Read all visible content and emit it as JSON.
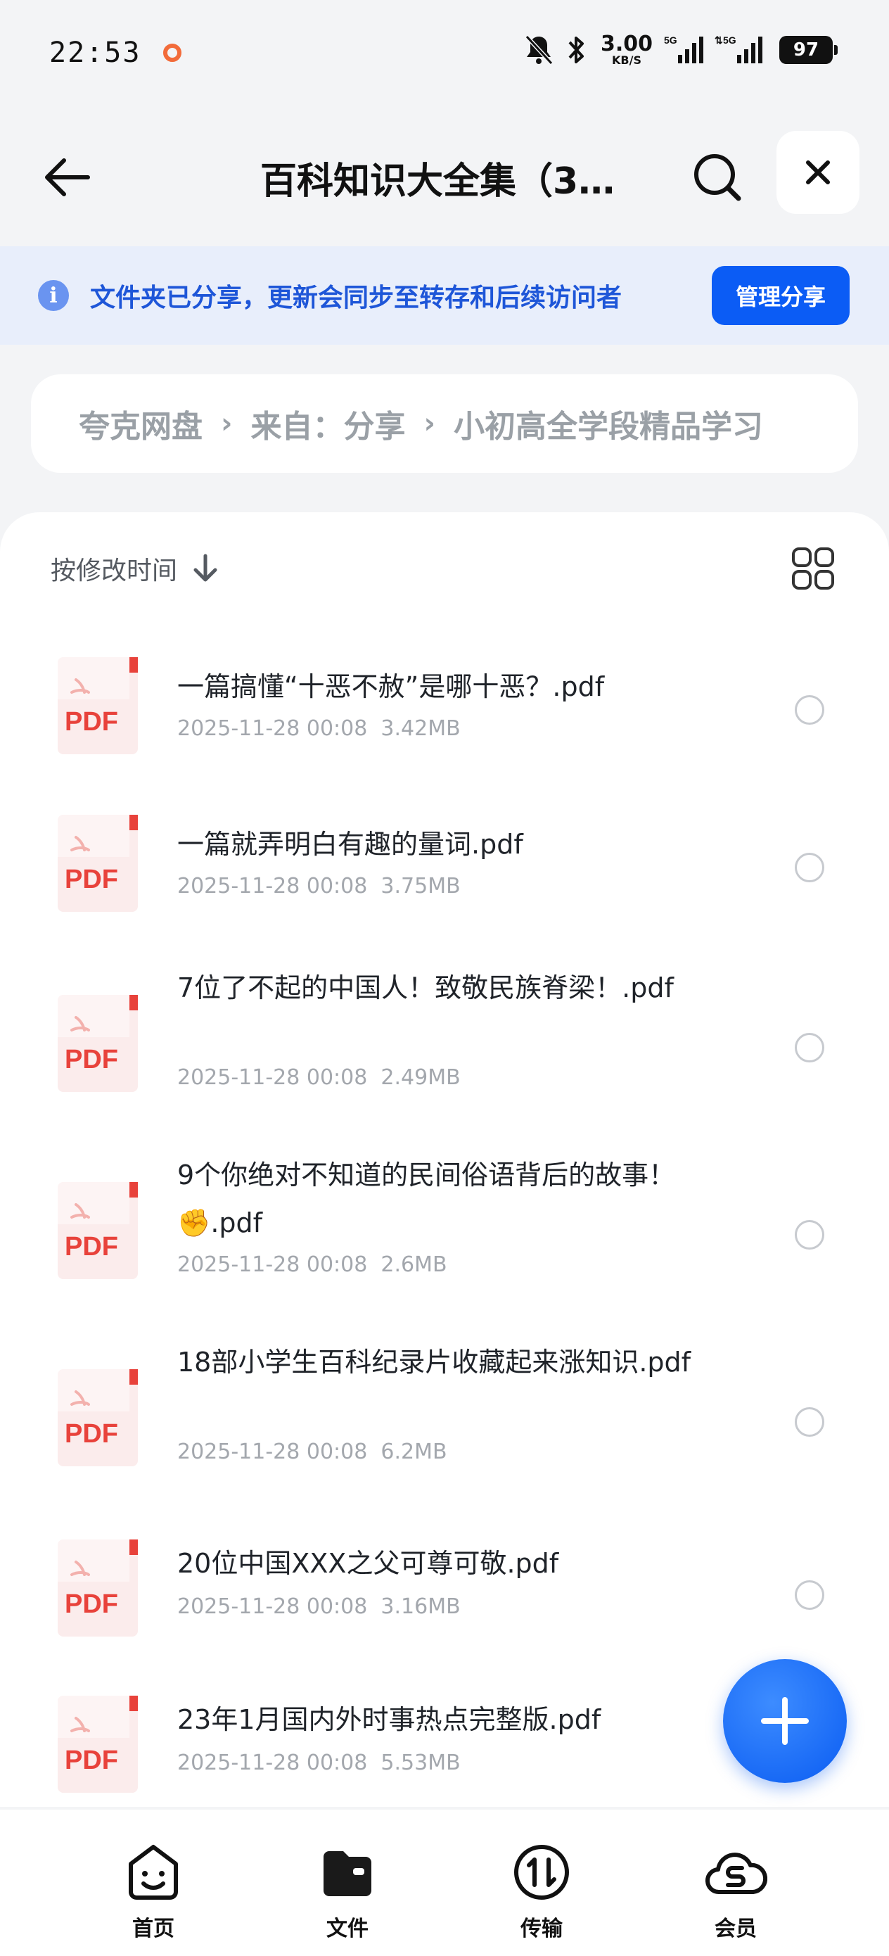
{
  "status": {
    "time": "22:53",
    "net_speed": "3.00",
    "net_unit": "KB/S",
    "signal_1": "5G",
    "signal_2": "5G",
    "battery": "97"
  },
  "header": {
    "title": "百科知识大全集（3…"
  },
  "share_banner": {
    "info_icon": "i",
    "message": "文件夹已分享，更新会同步至转存和后续访问者",
    "manage_label": "管理分享"
  },
  "breadcrumb": {
    "items": [
      "夸克网盘",
      "来自：分享",
      "小初高全学段精品学习"
    ]
  },
  "sort": {
    "label": "按修改时间"
  },
  "files": [
    {
      "name": "一篇搞懂“十恶不赦”是哪十恶？.pdf",
      "date": "2025-11-28 00:08",
      "size": "3.42MB",
      "icon_label": "PDF"
    },
    {
      "name": "一篇就弄明白有趣的量词.pdf",
      "date": "2025-11-28 00:08",
      "size": "3.75MB",
      "icon_label": "PDF"
    },
    {
      "name": "7位了不起的中国人！致敬民族脊梁！.pdf",
      "date": "2025-11-28 00:08",
      "size": "2.49MB",
      "icon_label": "PDF"
    },
    {
      "name": "9个你绝对不知道的民间俗语背后的故事！✊.pdf",
      "date": "2025-11-28 00:08",
      "size": "2.6MB",
      "icon_label": "PDF"
    },
    {
      "name": "18部小学生百科纪录片收藏起来涨知识.pdf",
      "date": "2025-11-28 00:08",
      "size": "6.2MB",
      "icon_label": "PDF"
    },
    {
      "name": "20位中国XXX之父可尊可敬.pdf",
      "date": "2025-11-28 00:08",
      "size": "3.16MB",
      "icon_label": "PDF"
    },
    {
      "name": "23年1月国内外时事热点完整版.pdf",
      "date": "2025-11-28 00:08",
      "size": "5.53MB",
      "icon_label": "PDF"
    }
  ],
  "tabs": [
    {
      "label": "首页",
      "icon": "smile-box-icon"
    },
    {
      "label": "文件",
      "icon": "folder-icon"
    },
    {
      "label": "传输",
      "icon": "transfer-icon"
    },
    {
      "label": "会员",
      "icon": "cloud-s-icon"
    }
  ],
  "colors": {
    "accent": "#0b5cf5",
    "banner_bg": "#e8eefb",
    "banner_text": "#1e56d8",
    "pdf_red": "#e8423b"
  }
}
